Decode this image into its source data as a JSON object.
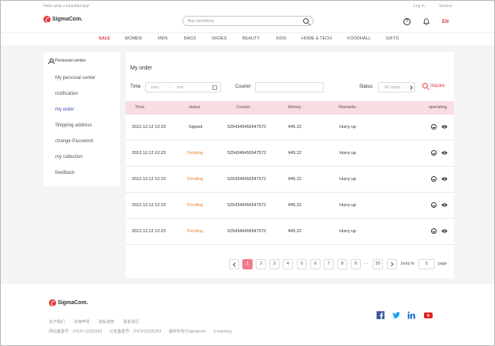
{
  "topbar": {
    "greeting": "Hello what a beautiful day!",
    "login": "Log in",
    "service": "Service"
  },
  "header": {
    "logo_text": "SigmaCom.",
    "search_placeholder": "Buy something",
    "language": "EN"
  },
  "nav": {
    "items": [
      "SALE",
      "WOMEN",
      "MEN",
      "BAGS",
      "SHOES",
      "BEAUTY",
      "KIDS",
      "HOME & TECH",
      "FOODHALL",
      "GIFTS"
    ],
    "active": "SALE"
  },
  "sidebar": {
    "header": "Personal center",
    "items": [
      "My personal center",
      "notification",
      "my order",
      "Shipping address",
      "change Password",
      "my collection",
      "feedback"
    ],
    "active": "my order"
  },
  "order": {
    "title": "My order",
    "filters": {
      "time_label": "Time",
      "date_start_placeholder": "start",
      "date_separator": "~",
      "date_end_placeholder": "end",
      "courier_label": "Courier",
      "courier_value": "",
      "status_label": "Status",
      "status_value": "All status",
      "inquire_label": "Inquire"
    },
    "columns": [
      "Time",
      "status",
      "Courier",
      "Money",
      "Remarks",
      "operating"
    ],
    "rows": [
      {
        "time": "2012.12.12 12:23",
        "status": "Signed",
        "courier": "5254346456547572",
        "money": "¥45.22",
        "remarks": "Hurry up"
      },
      {
        "time": "2012.12.12 12:23",
        "status": "Pending",
        "courier": "5254346456547572",
        "money": "¥45.22",
        "remarks": "Hurry up"
      },
      {
        "time": "2012.12.12 12:23",
        "status": "Pending",
        "courier": "5254346456547572",
        "money": "¥45.22",
        "remarks": "Hurry up"
      },
      {
        "time": "2012.12.12 12:23",
        "status": "Pending",
        "courier": "5254346456547572",
        "money": "¥45.22",
        "remarks": "Hurry up"
      },
      {
        "time": "2012.12.12 12:23",
        "status": "Pending",
        "courier": "5254346456547572",
        "money": "¥45.22",
        "remarks": "Hurry up"
      }
    ],
    "pagination": {
      "pages": [
        "1",
        "2",
        "3",
        "4",
        "5",
        "6",
        "7",
        "8",
        "9"
      ],
      "ellipsis": "···",
      "last_page": "20",
      "current": "1",
      "jump_label": "Jump to",
      "jump_value": "5",
      "page_label": "page"
    }
  },
  "footer": {
    "logo_text": "SigmaCom.",
    "links": [
      "关于我们",
      "法律声明",
      "隐私条款",
      "联系我们"
    ],
    "copyright": [
      "网站备案号：沪ICP-12235353",
      "公安备案号：沪ICP12235353",
      "版权所有©Sigmacom",
      "E-learning"
    ],
    "social": [
      "facebook-icon",
      "twitter-icon",
      "linkedin-icon",
      "youtube-icon"
    ]
  },
  "colors": {
    "accent": "#e03a3a",
    "pending": "#e8852a",
    "active_page": "#ef7c8e",
    "table_header": "#f8dde1",
    "active_link": "#3a4fa8"
  }
}
